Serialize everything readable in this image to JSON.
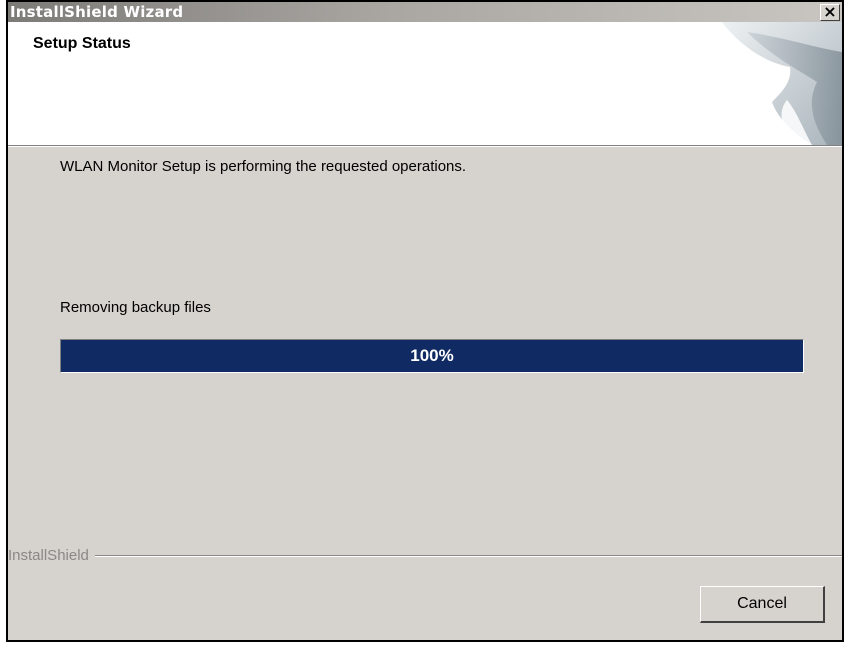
{
  "window": {
    "title": "InstallShield Wizard",
    "close_label": "×"
  },
  "header": {
    "title": "Setup Status"
  },
  "body": {
    "status_message": "WLAN Monitor Setup is performing the requested operations.",
    "current_action": "Removing backup files"
  },
  "progress": {
    "percent": 100,
    "label": "100%"
  },
  "footer": {
    "brand": "InstallShield",
    "cancel_label": "Cancel"
  },
  "colors": {
    "progress_fill": "#102a63",
    "dialog_background": "#d6d3ce"
  }
}
